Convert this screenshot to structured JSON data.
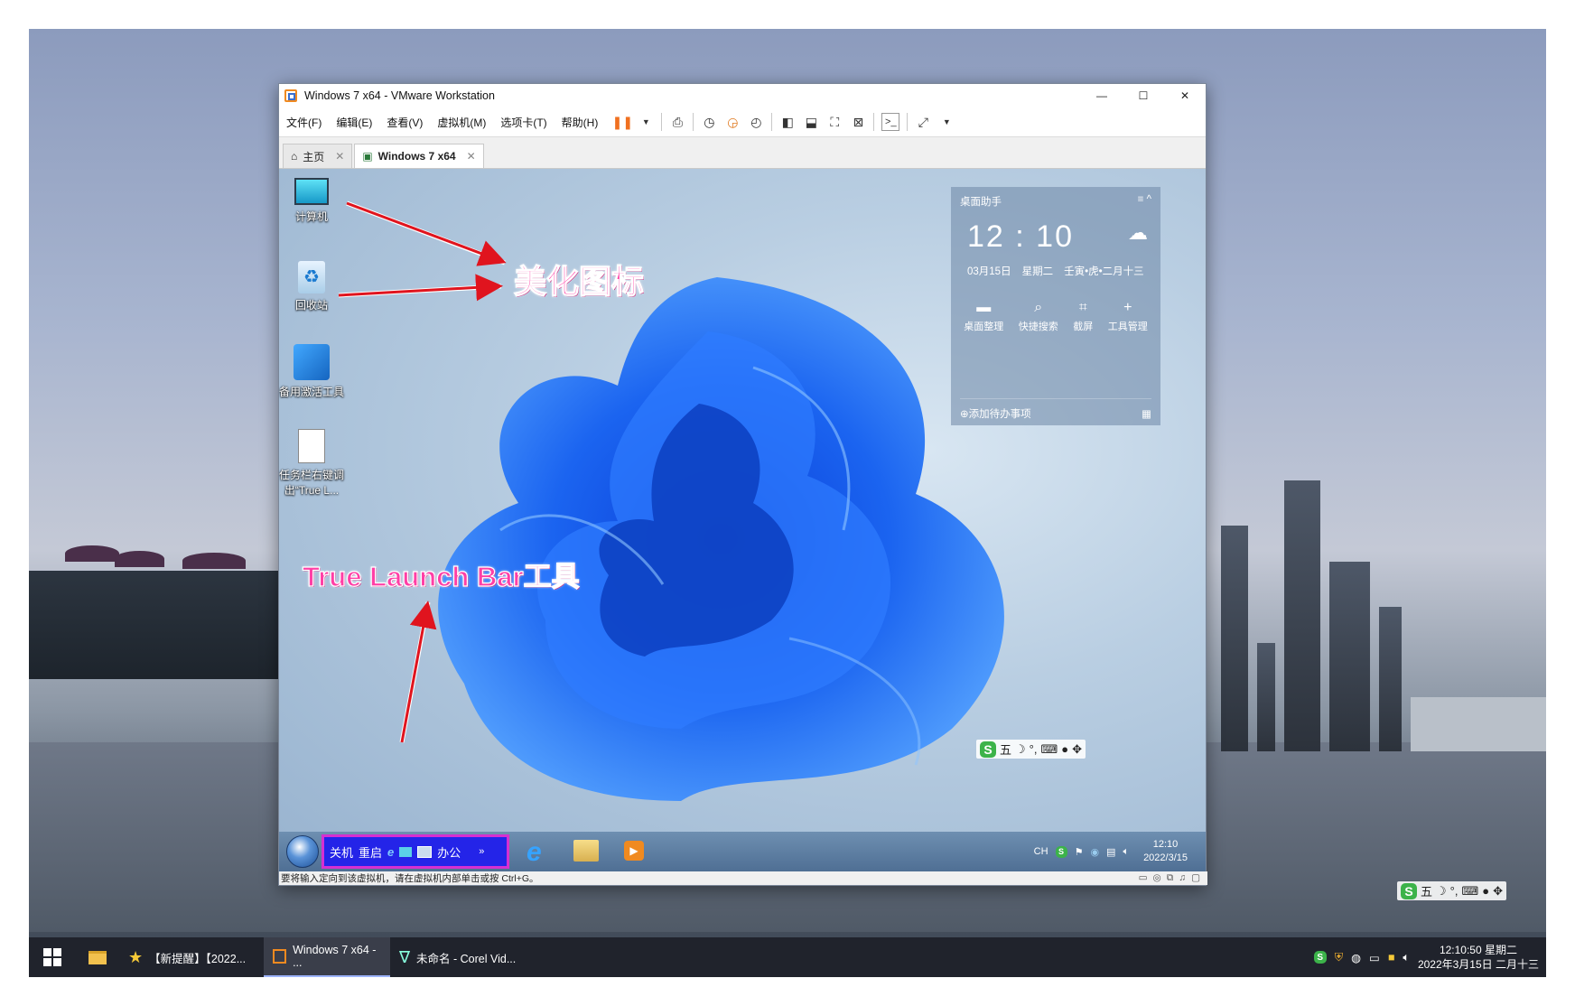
{
  "host": {
    "taskbar_items": [
      {
        "label": "【新提醒】【2022...",
        "icon": "star-icon"
      },
      {
        "label": "Windows 7 x64 - ...",
        "icon": "vmware-icon",
        "active": true
      },
      {
        "label": "未命名 - Corel Vid...",
        "icon": "corel-icon"
      }
    ],
    "clock_time": "12:10:50 星期二",
    "clock_date": "2022年3月15日 二月十三",
    "ime_label": "五"
  },
  "vmware": {
    "title": "Windows 7 x64 - VMware Workstation",
    "menu": [
      "文件(F)",
      "编辑(E)",
      "查看(V)",
      "虚拟机(M)",
      "选项卡(T)",
      "帮助(H)"
    ],
    "tabs": [
      {
        "label": "主页"
      },
      {
        "label": "Windows 7 x64",
        "selected": true
      }
    ],
    "status_text": "要将输入定向到该虚拟机，请在虚拟机内部单击或按 Ctrl+G。"
  },
  "guest": {
    "desktop_icons": [
      {
        "label": "计算机"
      },
      {
        "label": "回收站"
      },
      {
        "label": "备用激活工具"
      },
      {
        "label": "任务栏右键调出“True L..."
      }
    ],
    "annotations": {
      "beautify": "美化图标",
      "launchbar": "True Launch Bar工具"
    },
    "widget": {
      "title": "桌面助手",
      "time": "12 : 10",
      "date": "03月15日",
      "weekday": "星期二",
      "lunar": "壬寅•虎•二月十三",
      "tools": [
        "桌面整理",
        "快捷搜索",
        "截屏",
        "工具管理"
      ],
      "add_todo": "添加待办事项"
    },
    "launchbar": {
      "shutdown": "关机",
      "restart": "重启",
      "office": "办公",
      "more": "»"
    },
    "tray": {
      "lang": "CH",
      "time": "12:10",
      "date": "2022/3/15"
    },
    "ime_label": "五"
  },
  "colors": {
    "annotation": "#ff3fa6",
    "launchbar_bg": "#2424e8",
    "launchbar_border": "#d62fd1",
    "arrow": "#e0141e"
  }
}
